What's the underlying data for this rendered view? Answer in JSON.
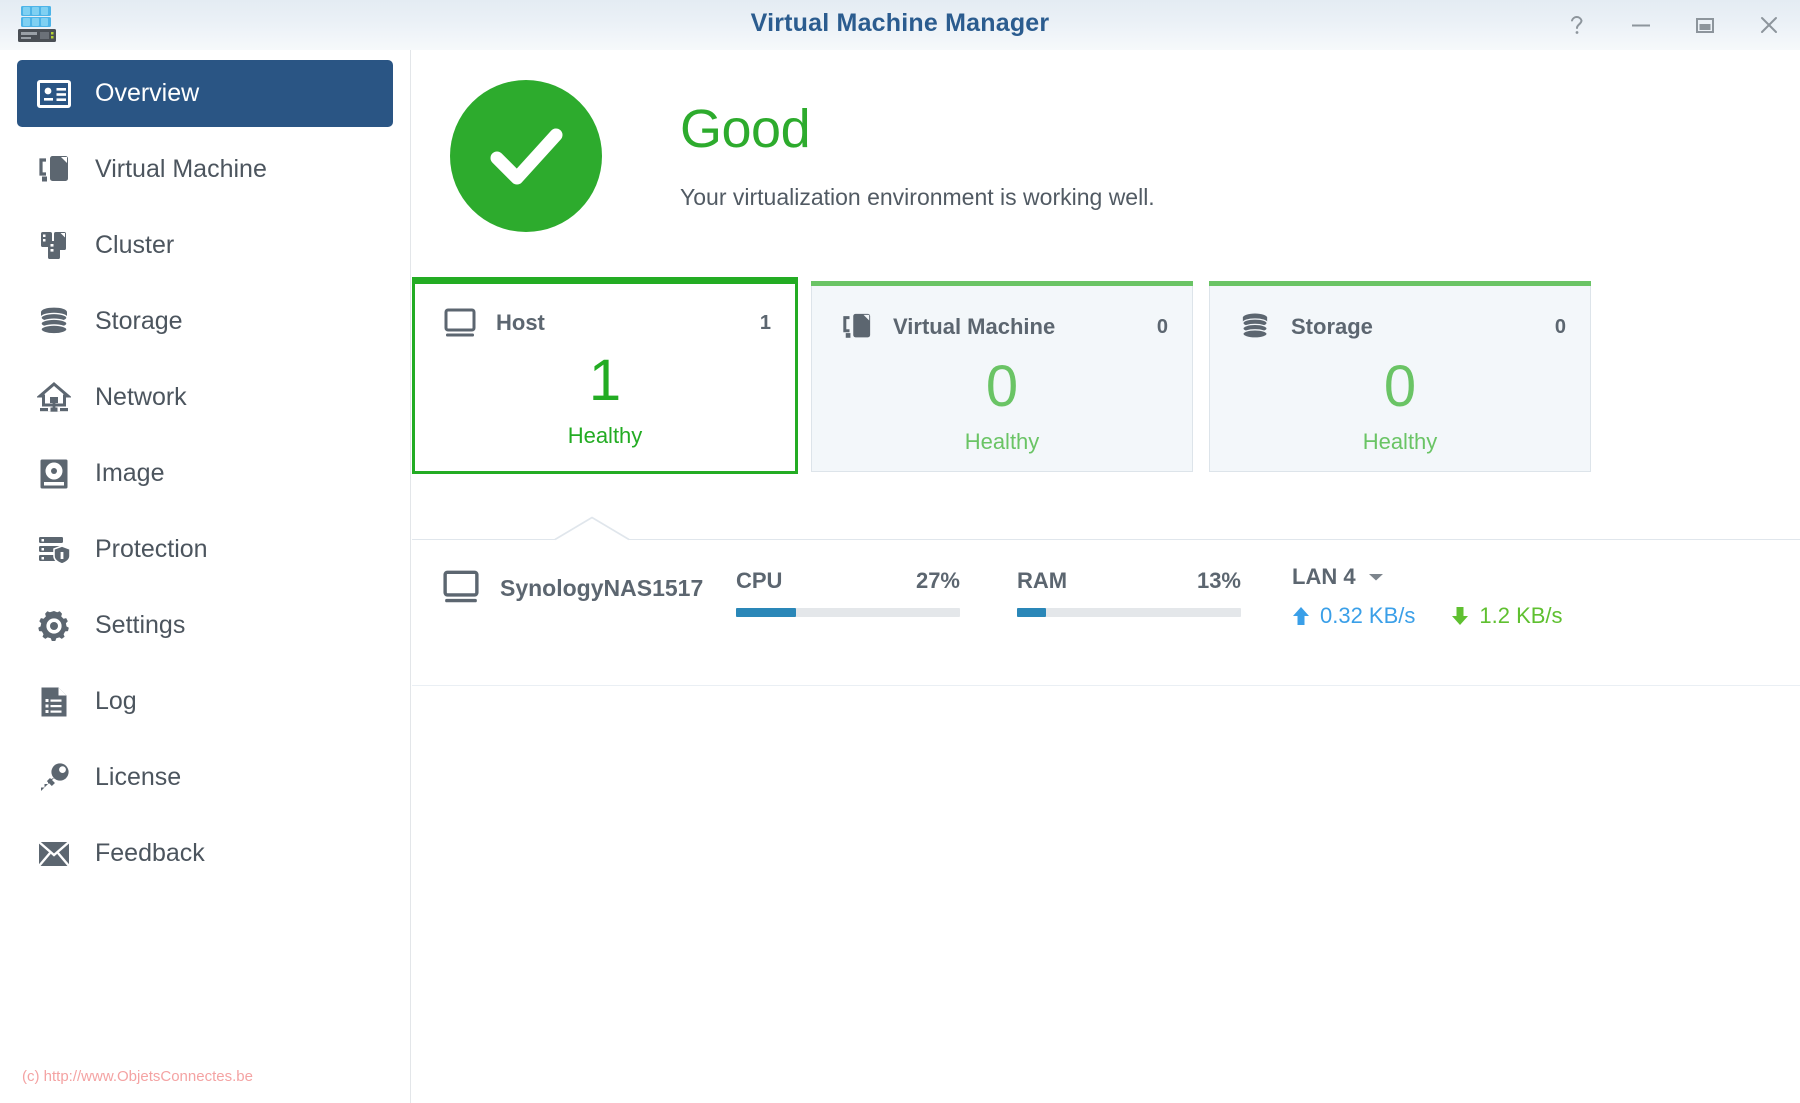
{
  "window": {
    "title": "Virtual Machine Manager",
    "app_icon": "synology-nas-icon",
    "controls": [
      {
        "name": "help-button",
        "glyph": "?"
      },
      {
        "name": "minimize-button",
        "glyph": "—"
      },
      {
        "name": "maximize-button",
        "glyph": "□"
      },
      {
        "name": "close-button",
        "glyph": "×"
      }
    ]
  },
  "sidebar": {
    "items": [
      {
        "label": "Overview",
        "icon": "overview-card-icon",
        "active": true
      },
      {
        "label": "Virtual Machine",
        "icon": "virtual-machine-icon",
        "active": false
      },
      {
        "label": "Cluster",
        "icon": "cluster-icon",
        "active": false
      },
      {
        "label": "Storage",
        "icon": "storage-database-icon",
        "active": false
      },
      {
        "label": "Network",
        "icon": "network-router-icon",
        "active": false
      },
      {
        "label": "Image",
        "icon": "image-disk-icon",
        "active": false
      },
      {
        "label": "Protection",
        "icon": "protection-shield-icon",
        "active": false
      },
      {
        "label": "Settings",
        "icon": "gear-icon",
        "active": false
      },
      {
        "label": "Log",
        "icon": "log-document-icon",
        "active": false
      },
      {
        "label": "License",
        "icon": "key-icon",
        "active": false
      },
      {
        "label": "Feedback",
        "icon": "envelope-icon",
        "active": false
      }
    ],
    "watermark": "(c) http://www.ObjetsConnectes.be"
  },
  "main": {
    "status": {
      "icon": "checkmark-circle-icon",
      "title": "Good",
      "subtitle": "Your virtualization environment is working well.",
      "color": "#2dab2d"
    },
    "cards": [
      {
        "name": "host",
        "icon": "monitor-icon",
        "title": "Host",
        "count": "1",
        "big_value": "1",
        "status": "Healthy",
        "selected": true,
        "accent": "#23ac23"
      },
      {
        "name": "virtual-machine",
        "icon": "virtual-machine-icon",
        "title": "Virtual Machine",
        "count": "0",
        "big_value": "0",
        "status": "Healthy",
        "selected": false,
        "accent": "#6ac465"
      },
      {
        "name": "storage",
        "icon": "storage-database-icon",
        "title": "Storage",
        "count": "0",
        "big_value": "0",
        "status": "Healthy",
        "selected": false,
        "accent": "#6ac465"
      }
    ],
    "host_detail": {
      "icon": "monitor-icon",
      "name": "SynologyNAS1517",
      "cpu": {
        "label": "CPU",
        "value": "27%",
        "percent": 27
      },
      "ram": {
        "label": "RAM",
        "value": "13%",
        "percent": 13
      },
      "lan": {
        "label": "LAN 4",
        "upload": "0.32 KB/s",
        "download": "1.2 KB/s",
        "upload_color": "#3a9fe8",
        "download_color": "#5fc030"
      }
    }
  }
}
